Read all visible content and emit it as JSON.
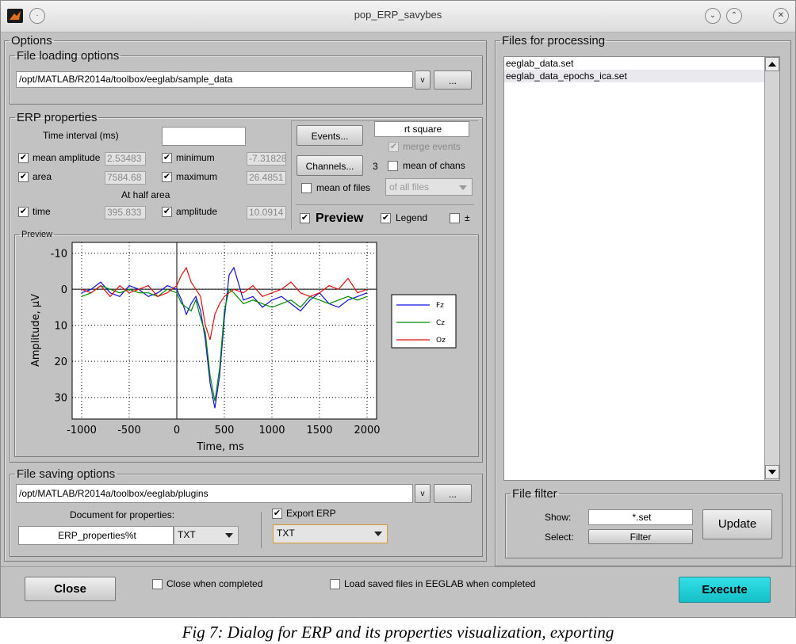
{
  "window": {
    "title": "pop_ERP_savybes"
  },
  "options_group": "Options",
  "file_loading": {
    "title": "File loading options",
    "path": "/opt/MATLAB/R2014a/toolbox/eeglab/sample_data",
    "dropdown_symbol": "v",
    "browse_label": "..."
  },
  "erp": {
    "title": "ERP properties",
    "time_interval_label": "Time interval (ms)",
    "time_interval_value": "",
    "mean_amplitude_label": "mean amplitude",
    "mean_amplitude_value": "2.53483",
    "minimum_label": "minimum",
    "minimum_value": "-7.31828",
    "area_label": "area",
    "area_value": "7584.68",
    "maximum_label": "maximum",
    "maximum_value": "26.4851",
    "half_area_label": "At half area",
    "time_label": "time",
    "time_value": "395.833",
    "amplitude_label": "amplitude",
    "amplitude_value": "10.0914",
    "events_label": "Events...",
    "events_value": "rt square",
    "merge_events_label": "merge events",
    "channels_label": "Channels...",
    "channels_count": "3",
    "mean_of_chans_label": "mean of chans",
    "mean_of_files_label": "mean of files",
    "of_all_files": "of all files",
    "preview_label": "Preview",
    "legend_label": "Legend",
    "pm_label": "±",
    "check": "✔"
  },
  "preview_group": "Preview",
  "chart_data": {
    "type": "line",
    "xlabel": "Time, ms",
    "ylabel": "Amplitude, µV",
    "xlim": [
      -1100,
      2100
    ],
    "ylim": [
      -13,
      36
    ],
    "y_reversed": true,
    "xticks": [
      "-1000",
      "-500",
      "0",
      "500",
      "1000",
      "1500",
      "2000"
    ],
    "yticks": [
      "-10",
      "0",
      "10",
      "20",
      "30"
    ],
    "grid": true,
    "legend_position": "right",
    "x": [
      -1000,
      -900,
      -800,
      -700,
      -600,
      -500,
      -400,
      -300,
      -200,
      -100,
      0,
      50,
      100,
      150,
      200,
      250,
      300,
      350,
      400,
      450,
      500,
      550,
      600,
      700,
      800,
      900,
      1000,
      1100,
      1200,
      1300,
      1400,
      1500,
      1600,
      1700,
      1800,
      1900,
      2000
    ],
    "series": [
      {
        "name": "Fz",
        "color": "#1010e0",
        "values": [
          1,
          0,
          -2,
          1,
          2,
          -1,
          0,
          2,
          1,
          -1,
          0,
          3,
          7,
          4,
          2,
          6,
          14,
          26,
          33,
          24,
          8,
          -4,
          -6,
          3,
          2,
          5,
          3,
          2,
          4,
          6,
          3,
          1,
          4,
          5,
          3,
          2,
          1
        ]
      },
      {
        "name": "Cz",
        "color": "#008a00",
        "values": [
          2,
          1,
          -1,
          0,
          1,
          0,
          1,
          1,
          2,
          0,
          1,
          4,
          5,
          6,
          3,
          8,
          12,
          24,
          31,
          22,
          6,
          0,
          1,
          4,
          3,
          4,
          5,
          4,
          3,
          5,
          2,
          3,
          4,
          3,
          2,
          3,
          2
        ]
      },
      {
        "name": "Oz",
        "color": "#e01010",
        "values": [
          0,
          1,
          -1,
          2,
          -1,
          1,
          0,
          -1,
          2,
          1,
          -1,
          -4,
          -6,
          -2,
          0,
          2,
          10,
          14,
          7,
          4,
          2,
          1,
          0,
          1,
          -1,
          2,
          1,
          0,
          -2,
          1,
          2,
          1,
          -1,
          0,
          -3,
          1,
          0
        ]
      }
    ]
  },
  "file_saving": {
    "title": "File saving options",
    "path": "/opt/MATLAB/R2014a/toolbox/eeglab/plugins",
    "dropdown_symbol": "v",
    "browse_label": "...",
    "document_label": "Document for properties:",
    "document_name": "ERP_properties%t",
    "doc_format": "TXT",
    "export_erp_label": "Export ERP",
    "export_format": "TXT"
  },
  "files": {
    "title": "Files for processing",
    "items": [
      "eeglab_data.set",
      "eeglab_data_epochs_ica.set"
    ],
    "filter_title": "File filter",
    "show_label": "Show:",
    "show_value": "*.set",
    "select_label": "Select:",
    "filter_button": "Filter",
    "update_button": "Update"
  },
  "bottom": {
    "close_button": "Close",
    "close_when_completed": "Close when completed",
    "load_saved": "Load saved files in EEGLAB when completed",
    "execute_button": "Execute"
  },
  "caption": "Fig 7: Dialog for ERP and its properties visualization, exporting"
}
